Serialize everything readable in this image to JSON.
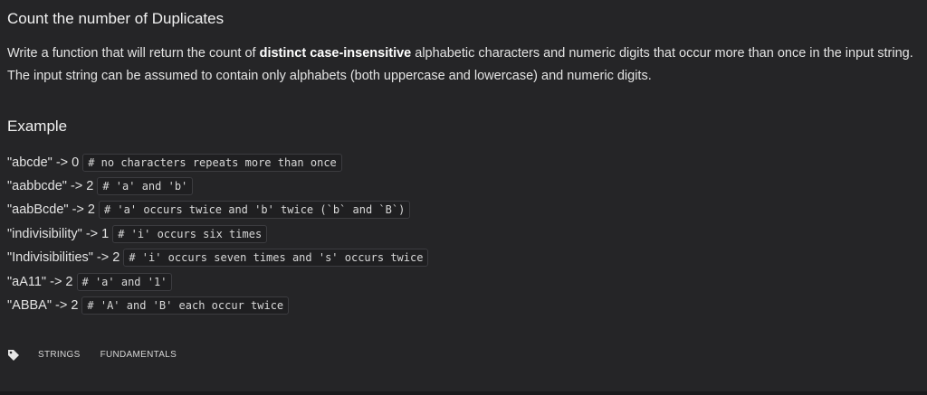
{
  "title": "Count the number of Duplicates",
  "description": {
    "part1": "Write a function that will return the count of ",
    "bold": "distinct case-insensitive",
    "part2": " alphabetic characters and numeric digits that occur more than once in the input string. The input string can be assumed to contain only alphabets (both uppercase and lowercase) and numeric digits."
  },
  "example_heading": "Example",
  "examples": [
    {
      "text": "\"abcde\" -> 0",
      "code": "# no characters repeats more than once"
    },
    {
      "text": "\"aabbcde\" -> 2",
      "code": "# 'a' and 'b'"
    },
    {
      "text": "\"aabBcde\" -> 2",
      "code": "# 'a' occurs twice and 'b' twice (`b` and `B`)"
    },
    {
      "text": "\"indivisibility\" -> 1",
      "code": "# 'i' occurs six times"
    },
    {
      "text": "\"Indivisibilities\" -> 2",
      "code": "# 'i' occurs seven times and 's' occurs twice"
    },
    {
      "text": "\"aA11\" -> 2",
      "code": "# 'a' and '1'"
    },
    {
      "text": "\"ABBA\" -> 2",
      "code": "# 'A' and 'B' each occur twice"
    }
  ],
  "tags": {
    "icon": "tag-icon",
    "items": [
      "STRINGS",
      "FUNDAMENTALS"
    ]
  }
}
